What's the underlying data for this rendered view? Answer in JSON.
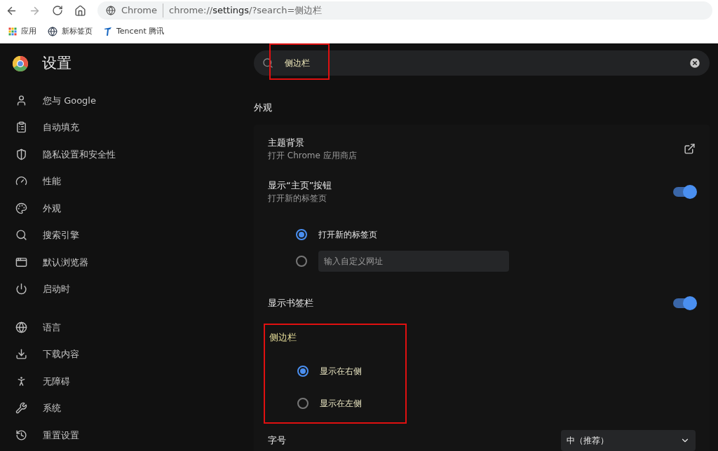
{
  "browser": {
    "site_label": "Chrome",
    "url": "chrome://**settings**/?search=侧边栏",
    "bookmarks": [
      {
        "label": "应用",
        "kind": "apps"
      },
      {
        "label": "新标签页",
        "kind": "globe"
      },
      {
        "label": "Tencent 腾讯",
        "kind": "tencent"
      }
    ]
  },
  "settings_title": "设置",
  "nav_groups": [
    [
      {
        "label": "您与 Google"
      },
      {
        "label": "自动填充"
      },
      {
        "label": "隐私设置和安全性"
      },
      {
        "label": "性能"
      },
      {
        "label": "外观"
      },
      {
        "label": "搜索引擎"
      },
      {
        "label": "默认浏览器"
      },
      {
        "label": "启动时"
      }
    ],
    [
      {
        "label": "语言"
      },
      {
        "label": "下载内容"
      },
      {
        "label": "无障碍"
      },
      {
        "label": "系统"
      },
      {
        "label": "重置设置"
      }
    ]
  ],
  "search": {
    "value": "侧边栏",
    "highlighted": true
  },
  "section_title": "外观",
  "rows": [
    {
      "kind": "link",
      "title": "主题背景",
      "subtitle": "打开 Chrome 应用商店"
    },
    {
      "kind": "toggle",
      "title": "显示“主页”按钮",
      "subtitle": "打开新的标签页",
      "on": true
    },
    {
      "kind": "radios",
      "options": [
        {
          "label": "打开新的标签页",
          "selected": true,
          "kind": "text"
        },
        {
          "placeholder": "输入自定义网址",
          "selected": false,
          "kind": "input"
        }
      ]
    },
    {
      "kind": "toggle",
      "title": "显示书签栏",
      "on": true
    },
    {
      "kind": "radios",
      "highlighted": true,
      "title": "侧边栏",
      "options": [
        {
          "label": "显示在右侧",
          "selected": true,
          "kind": "text"
        },
        {
          "label": "显示在左侧",
          "selected": false,
          "kind": "text"
        }
      ]
    },
    {
      "kind": "select",
      "title": "字号",
      "value": "中（推荐）"
    }
  ]
}
